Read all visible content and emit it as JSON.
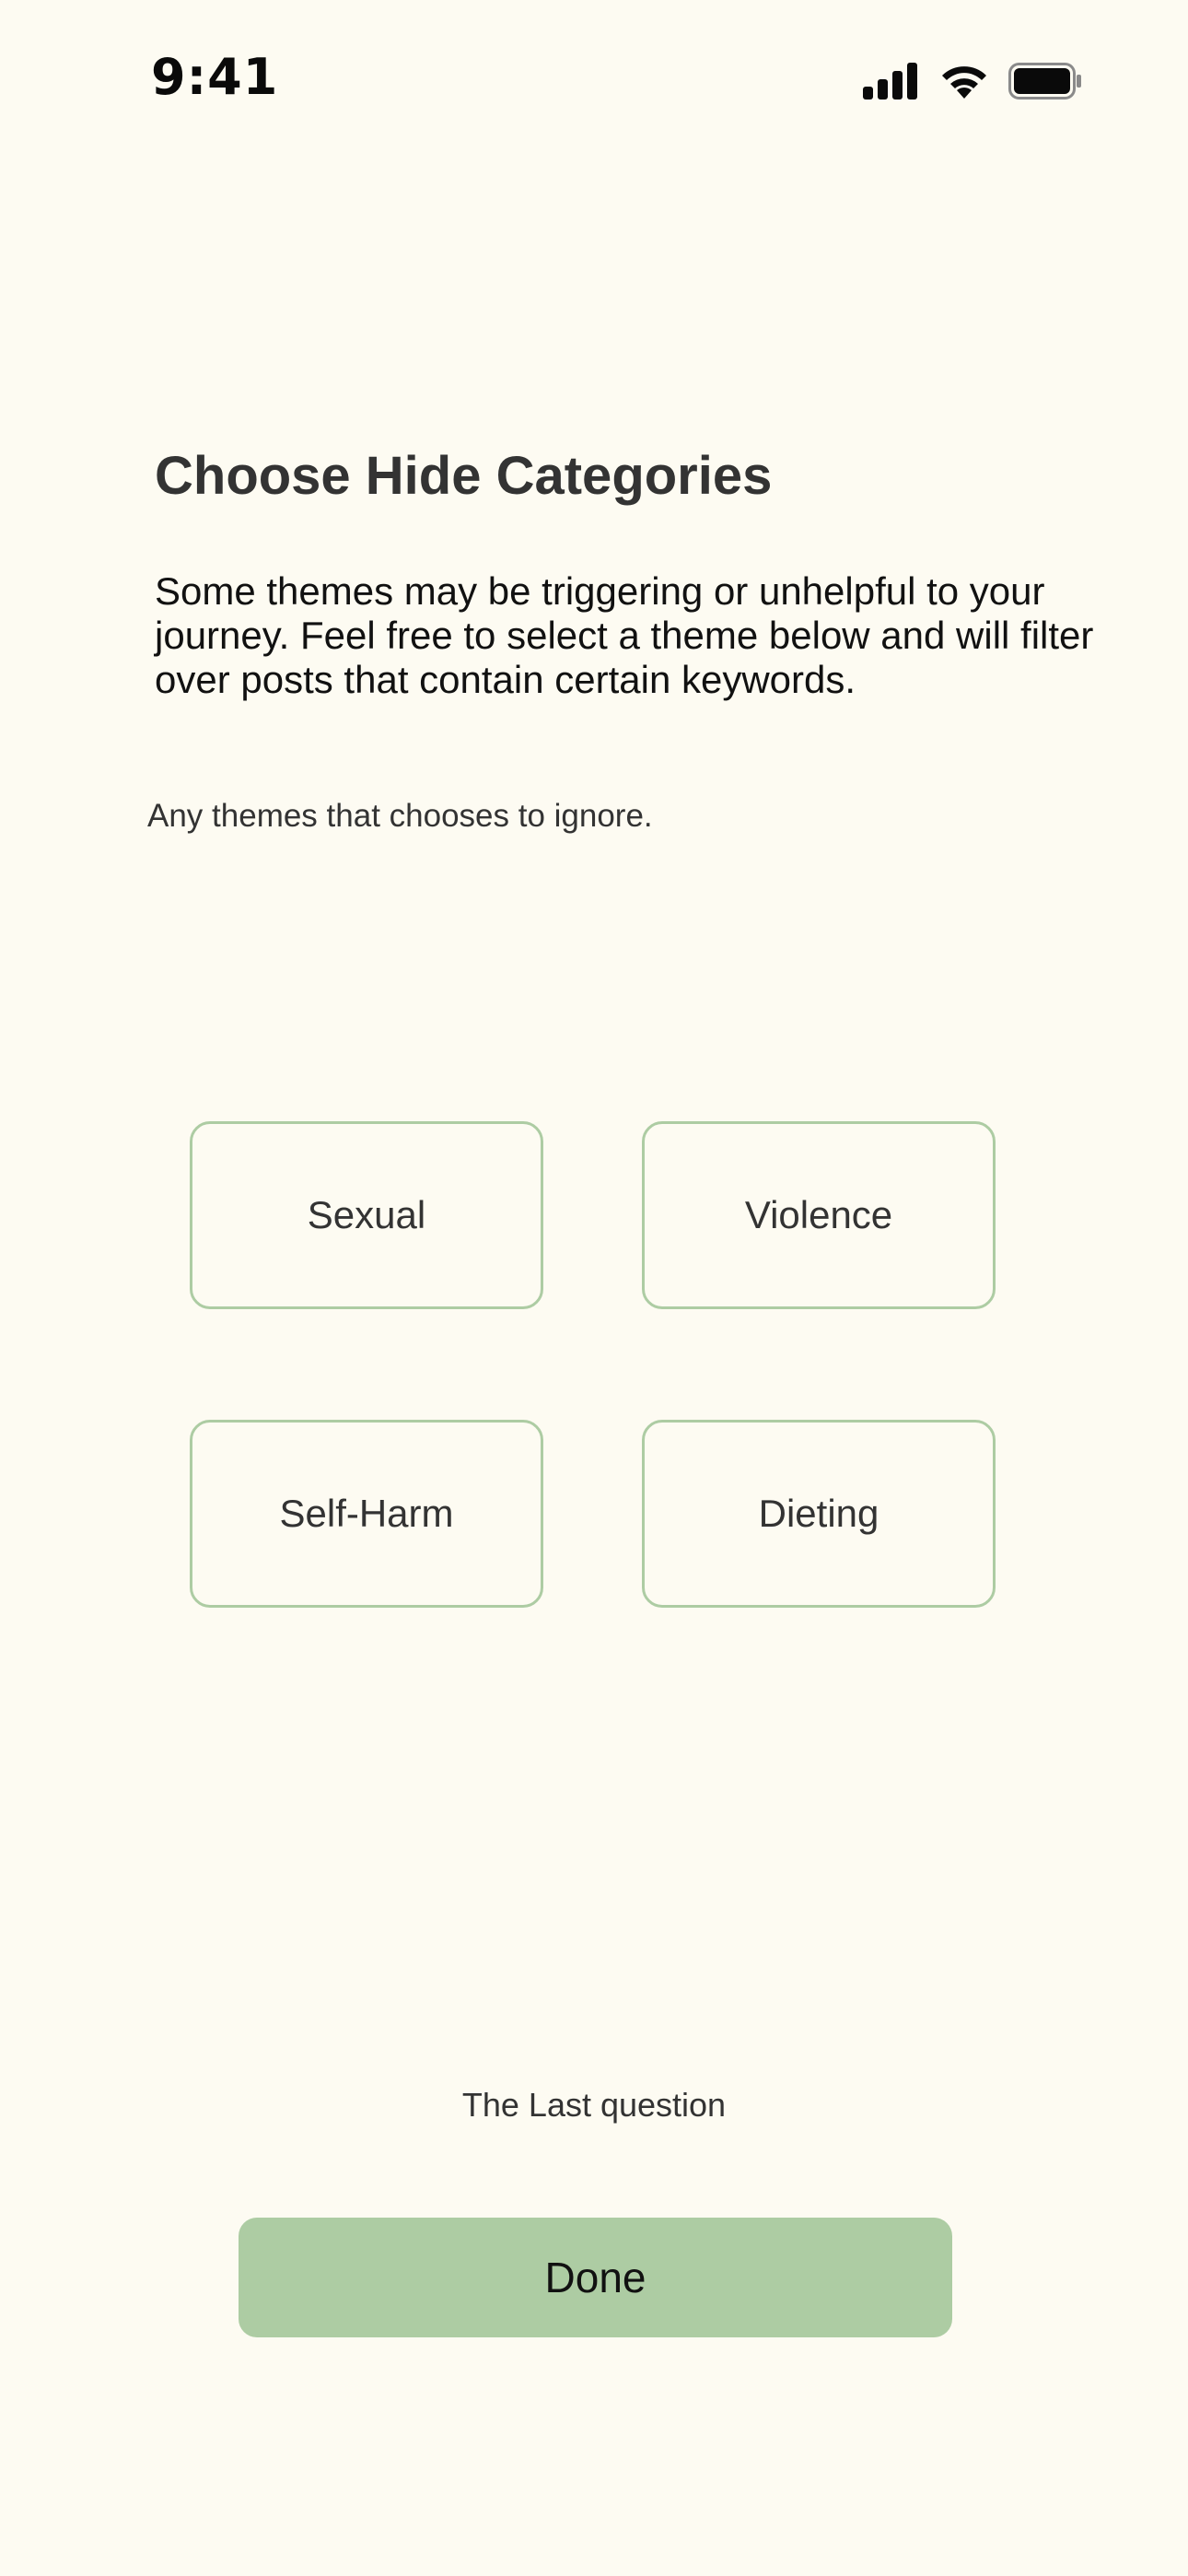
{
  "status_bar": {
    "time": "9:41",
    "icons": [
      "cellular-signal-icon",
      "wifi-icon",
      "battery-icon"
    ]
  },
  "screen": {
    "title": "Choose Hide Categories",
    "description": "Some themes may be triggering or unhelpful to your journey. Feel free to select a theme below and will filter over posts that contain certain keywords.",
    "hint": "Any themes that chooses to ignore."
  },
  "categories": [
    {
      "label": "Sexual"
    },
    {
      "label": "Violence"
    },
    {
      "label": "Self-Harm"
    },
    {
      "label": "Dieting"
    }
  ],
  "footer": {
    "progress_label": "The Last question",
    "done_label": "Done"
  },
  "colors": {
    "background": "#FDFBF2",
    "accent_green": "#ADCCA3",
    "text_dark": "#333333"
  }
}
